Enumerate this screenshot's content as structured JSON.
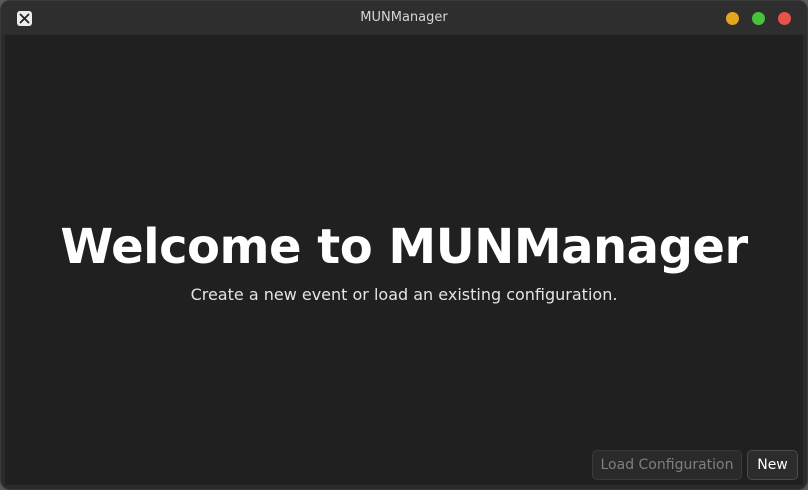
{
  "window": {
    "title": "MUNManager",
    "app_icon": "x-logo-icon",
    "controls": {
      "minimize_color": "#e6a521",
      "maximize_color": "#47c23b",
      "close_color": "#e6534b"
    }
  },
  "welcome": {
    "title": "Welcome to MUNManager",
    "subtitle": "Create a new event or load an existing configuration."
  },
  "actions": {
    "load_label": "Load Configuration",
    "new_label": "New"
  },
  "colors": {
    "content_background": "#202020",
    "titlebar_background": "#2e2e2e"
  }
}
